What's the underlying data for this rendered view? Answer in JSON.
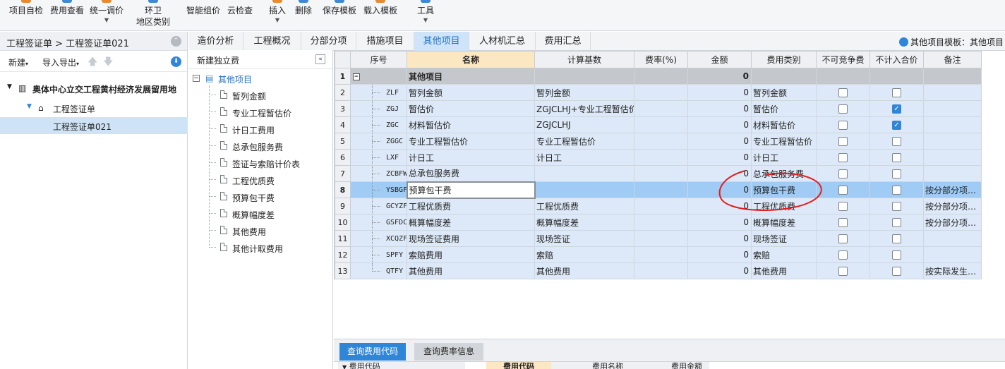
{
  "toolbar": {
    "items": [
      {
        "label": "项目自检"
      },
      {
        "label": "费用查看"
      },
      {
        "label": "统一调价"
      },
      {
        "label": "环卫",
        "label2": "地区类别"
      },
      {
        "label": "智能组价"
      },
      {
        "label": "云检查"
      },
      {
        "label": "插入"
      },
      {
        "label": "删除"
      },
      {
        "label": "保存模板"
      },
      {
        "label": "载入模板"
      },
      {
        "label": "工具"
      }
    ]
  },
  "left": {
    "breadcrumb": "工程签证单 > 工程签证单021",
    "new_label": "新建",
    "import_export_label": "导入导出",
    "tree": {
      "root": "奥体中心立交工程黄村经济发展留用地",
      "group": "工程签证单",
      "selected": "工程签证单021"
    }
  },
  "mid": {
    "header": "新建独立费",
    "root": "其他项目",
    "items": [
      "暂列金额",
      "专业工程暂估价",
      "计日工费用",
      "总承包服务费",
      "签证与索赔计价表",
      "工程优质费",
      "预算包干费",
      "概算幅度差",
      "其他费用",
      "其他计取费用"
    ]
  },
  "tabs": [
    "造价分析",
    "工程概况",
    "分部分项",
    "措施项目",
    "其他项目",
    "人材机汇总",
    "费用汇总"
  ],
  "active_tab": "其他项目",
  "template_label": "其他项目模板：其他项目",
  "grid": {
    "headers": [
      "序号",
      "名称",
      "计算基数",
      "费率(%)",
      "金额",
      "费用类别",
      "不可竞争费",
      "不计入合价",
      "备注"
    ],
    "rows": [
      {
        "n": "1",
        "code": "",
        "name": "其他项目",
        "base": "",
        "rate": "",
        "amount": "0",
        "cat": "",
        "c1": null,
        "c2": null,
        "note": ""
      },
      {
        "n": "2",
        "code": "ZLF",
        "name": "暂列金额",
        "base": "暂列金额",
        "rate": "",
        "amount": "0",
        "cat": "暂列金额",
        "c1": false,
        "c2": false,
        "note": ""
      },
      {
        "n": "3",
        "code": "ZGJ",
        "name": "暂估价",
        "base": "ZGJCLHJ+专业工程暂估价",
        "rate": "",
        "amount": "0",
        "cat": "暂估价",
        "c1": false,
        "c2": true,
        "note": ""
      },
      {
        "n": "4",
        "code": "ZGC",
        "name": "材料暂估价",
        "base": "ZGJCLHJ",
        "rate": "",
        "amount": "0",
        "cat": "材料暂估价",
        "c1": false,
        "c2": true,
        "note": ""
      },
      {
        "n": "5",
        "code": "ZGGC",
        "name": "专业工程暂估价",
        "base": "专业工程暂估价",
        "rate": "",
        "amount": "0",
        "cat": "专业工程暂估价",
        "c1": false,
        "c2": false,
        "note": ""
      },
      {
        "n": "6",
        "code": "LXF",
        "name": "计日工",
        "base": "计日工",
        "rate": "",
        "amount": "0",
        "cat": "计日工",
        "c1": false,
        "c2": false,
        "note": ""
      },
      {
        "n": "7",
        "code": "ZCBFWF",
        "name": "总承包服务费",
        "base": "",
        "rate": "",
        "amount": "0",
        "cat": "总承包服务费",
        "c1": false,
        "c2": false,
        "note": ""
      },
      {
        "n": "8",
        "code": "YSBGF",
        "name": "预算包干费",
        "base": "",
        "rate": "",
        "amount": "0",
        "cat": "预算包干费",
        "c1": false,
        "c2": false,
        "note": "按分部分项…"
      },
      {
        "n": "9",
        "code": "GCYZF",
        "name": "工程优质费",
        "base": "工程优质费",
        "rate": "",
        "amount": "0",
        "cat": "工程优质费",
        "c1": false,
        "c2": false,
        "note": "按分部分项…"
      },
      {
        "n": "10",
        "code": "GSFDC",
        "name": "概算幅度差",
        "base": "概算幅度差",
        "rate": "",
        "amount": "0",
        "cat": "概算幅度差",
        "c1": false,
        "c2": false,
        "note": "按分部分项…"
      },
      {
        "n": "11",
        "code": "XCQZFY",
        "name": "现场签证费用",
        "base": "现场签证",
        "rate": "",
        "amount": "0",
        "cat": "现场签证",
        "c1": false,
        "c2": false,
        "note": ""
      },
      {
        "n": "12",
        "code": "SPFY",
        "name": "索赔费用",
        "base": "索赔",
        "rate": "",
        "amount": "0",
        "cat": "索赔",
        "c1": false,
        "c2": false,
        "note": ""
      },
      {
        "n": "13",
        "code": "QTFY",
        "name": "其他费用",
        "base": "其他费用",
        "rate": "",
        "amount": "0",
        "cat": "其他费用",
        "c1": false,
        "c2": false,
        "note": "按实际发生…"
      }
    ]
  },
  "bottom": {
    "tab_code": "查询费用代码",
    "tab_rate": "查询费率信息",
    "col_a": "费用代码",
    "col_b": "费用代码",
    "col_c": "费用名称",
    "col_d": "费用金额"
  }
}
